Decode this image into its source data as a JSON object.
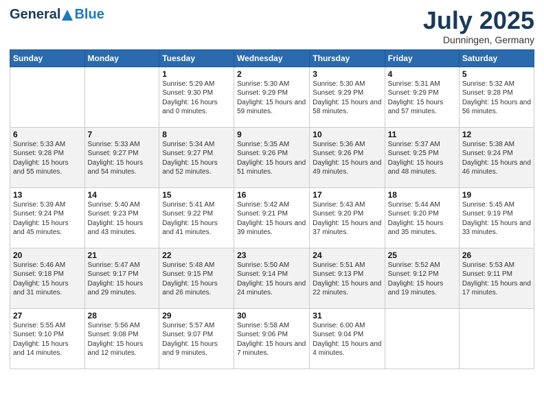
{
  "logo": {
    "general": "General",
    "blue": "Blue"
  },
  "header": {
    "month": "July 2025",
    "location": "Dunningen, Germany"
  },
  "weekdays": [
    "Sunday",
    "Monday",
    "Tuesday",
    "Wednesday",
    "Thursday",
    "Friday",
    "Saturday"
  ],
  "weeks": [
    [
      {
        "day": "",
        "sunrise": "",
        "sunset": "",
        "daylight": ""
      },
      {
        "day": "",
        "sunrise": "",
        "sunset": "",
        "daylight": ""
      },
      {
        "day": "1",
        "sunrise": "Sunrise: 5:29 AM",
        "sunset": "Sunset: 9:30 PM",
        "daylight": "Daylight: 16 hours and 0 minutes."
      },
      {
        "day": "2",
        "sunrise": "Sunrise: 5:30 AM",
        "sunset": "Sunset: 9:29 PM",
        "daylight": "Daylight: 15 hours and 59 minutes."
      },
      {
        "day": "3",
        "sunrise": "Sunrise: 5:30 AM",
        "sunset": "Sunset: 9:29 PM",
        "daylight": "Daylight: 15 hours and 58 minutes."
      },
      {
        "day": "4",
        "sunrise": "Sunrise: 5:31 AM",
        "sunset": "Sunset: 9:29 PM",
        "daylight": "Daylight: 15 hours and 57 minutes."
      },
      {
        "day": "5",
        "sunrise": "Sunrise: 5:32 AM",
        "sunset": "Sunset: 9:28 PM",
        "daylight": "Daylight: 15 hours and 56 minutes."
      }
    ],
    [
      {
        "day": "6",
        "sunrise": "Sunrise: 5:33 AM",
        "sunset": "Sunset: 9:28 PM",
        "daylight": "Daylight: 15 hours and 55 minutes."
      },
      {
        "day": "7",
        "sunrise": "Sunrise: 5:33 AM",
        "sunset": "Sunset: 9:27 PM",
        "daylight": "Daylight: 15 hours and 54 minutes."
      },
      {
        "day": "8",
        "sunrise": "Sunrise: 5:34 AM",
        "sunset": "Sunset: 9:27 PM",
        "daylight": "Daylight: 15 hours and 52 minutes."
      },
      {
        "day": "9",
        "sunrise": "Sunrise: 5:35 AM",
        "sunset": "Sunset: 9:26 PM",
        "daylight": "Daylight: 15 hours and 51 minutes."
      },
      {
        "day": "10",
        "sunrise": "Sunrise: 5:36 AM",
        "sunset": "Sunset: 9:26 PM",
        "daylight": "Daylight: 15 hours and 49 minutes."
      },
      {
        "day": "11",
        "sunrise": "Sunrise: 5:37 AM",
        "sunset": "Sunset: 9:25 PM",
        "daylight": "Daylight: 15 hours and 48 minutes."
      },
      {
        "day": "12",
        "sunrise": "Sunrise: 5:38 AM",
        "sunset": "Sunset: 9:24 PM",
        "daylight": "Daylight: 15 hours and 46 minutes."
      }
    ],
    [
      {
        "day": "13",
        "sunrise": "Sunrise: 5:39 AM",
        "sunset": "Sunset: 9:24 PM",
        "daylight": "Daylight: 15 hours and 45 minutes."
      },
      {
        "day": "14",
        "sunrise": "Sunrise: 5:40 AM",
        "sunset": "Sunset: 9:23 PM",
        "daylight": "Daylight: 15 hours and 43 minutes."
      },
      {
        "day": "15",
        "sunrise": "Sunrise: 5:41 AM",
        "sunset": "Sunset: 9:22 PM",
        "daylight": "Daylight: 15 hours and 41 minutes."
      },
      {
        "day": "16",
        "sunrise": "Sunrise: 5:42 AM",
        "sunset": "Sunset: 9:21 PM",
        "daylight": "Daylight: 15 hours and 39 minutes."
      },
      {
        "day": "17",
        "sunrise": "Sunrise: 5:43 AM",
        "sunset": "Sunset: 9:20 PM",
        "daylight": "Daylight: 15 hours and 37 minutes."
      },
      {
        "day": "18",
        "sunrise": "Sunrise: 5:44 AM",
        "sunset": "Sunset: 9:20 PM",
        "daylight": "Daylight: 15 hours and 35 minutes."
      },
      {
        "day": "19",
        "sunrise": "Sunrise: 5:45 AM",
        "sunset": "Sunset: 9:19 PM",
        "daylight": "Daylight: 15 hours and 33 minutes."
      }
    ],
    [
      {
        "day": "20",
        "sunrise": "Sunrise: 5:46 AM",
        "sunset": "Sunset: 9:18 PM",
        "daylight": "Daylight: 15 hours and 31 minutes."
      },
      {
        "day": "21",
        "sunrise": "Sunrise: 5:47 AM",
        "sunset": "Sunset: 9:17 PM",
        "daylight": "Daylight: 15 hours and 29 minutes."
      },
      {
        "day": "22",
        "sunrise": "Sunrise: 5:48 AM",
        "sunset": "Sunset: 9:15 PM",
        "daylight": "Daylight: 15 hours and 26 minutes."
      },
      {
        "day": "23",
        "sunrise": "Sunrise: 5:50 AM",
        "sunset": "Sunset: 9:14 PM",
        "daylight": "Daylight: 15 hours and 24 minutes."
      },
      {
        "day": "24",
        "sunrise": "Sunrise: 5:51 AM",
        "sunset": "Sunset: 9:13 PM",
        "daylight": "Daylight: 15 hours and 22 minutes."
      },
      {
        "day": "25",
        "sunrise": "Sunrise: 5:52 AM",
        "sunset": "Sunset: 9:12 PM",
        "daylight": "Daylight: 15 hours and 19 minutes."
      },
      {
        "day": "26",
        "sunrise": "Sunrise: 5:53 AM",
        "sunset": "Sunset: 9:11 PM",
        "daylight": "Daylight: 15 hours and 17 minutes."
      }
    ],
    [
      {
        "day": "27",
        "sunrise": "Sunrise: 5:55 AM",
        "sunset": "Sunset: 9:10 PM",
        "daylight": "Daylight: 15 hours and 14 minutes."
      },
      {
        "day": "28",
        "sunrise": "Sunrise: 5:56 AM",
        "sunset": "Sunset: 9:08 PM",
        "daylight": "Daylight: 15 hours and 12 minutes."
      },
      {
        "day": "29",
        "sunrise": "Sunrise: 5:57 AM",
        "sunset": "Sunset: 9:07 PM",
        "daylight": "Daylight: 15 hours and 9 minutes."
      },
      {
        "day": "30",
        "sunrise": "Sunrise: 5:58 AM",
        "sunset": "Sunset: 9:06 PM",
        "daylight": "Daylight: 15 hours and 7 minutes."
      },
      {
        "day": "31",
        "sunrise": "Sunrise: 6:00 AM",
        "sunset": "Sunset: 9:04 PM",
        "daylight": "Daylight: 15 hours and 4 minutes."
      },
      {
        "day": "",
        "sunrise": "",
        "sunset": "",
        "daylight": ""
      },
      {
        "day": "",
        "sunrise": "",
        "sunset": "",
        "daylight": ""
      }
    ]
  ]
}
